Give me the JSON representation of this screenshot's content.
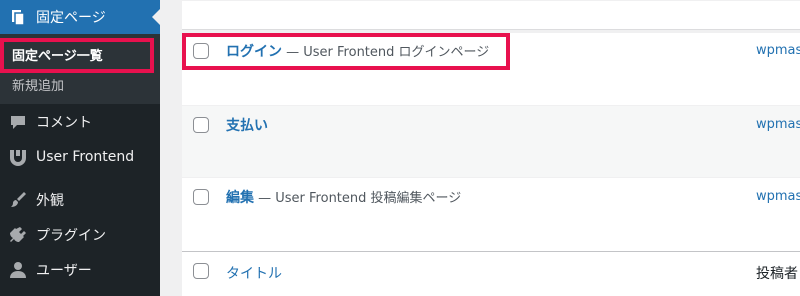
{
  "sidebar": {
    "pages_label": "固定ページ",
    "sub_all_pages": "固定ページ一覧",
    "sub_add_new": "新規追加",
    "comments_label": "コメント",
    "user_frontend_label": "User Frontend",
    "appearance_label": "外観",
    "plugins_label": "プラグイン",
    "users_label": "ユーザー"
  },
  "rows": [
    {
      "link": "ログイン",
      "suffix": " — User Frontend ログインページ",
      "author": "wpmast"
    },
    {
      "link": "支払い",
      "suffix": "",
      "author": "wpmast"
    },
    {
      "link": "編集",
      "suffix": " — User Frontend 投稿編集ページ",
      "author": "wpmast"
    }
  ],
  "footer": {
    "title_header": "タイトル",
    "author_header": "投稿者"
  },
  "colors": {
    "accent": "#2271b1",
    "highlight": "#e8114e",
    "sidebar": "#1d2327"
  }
}
